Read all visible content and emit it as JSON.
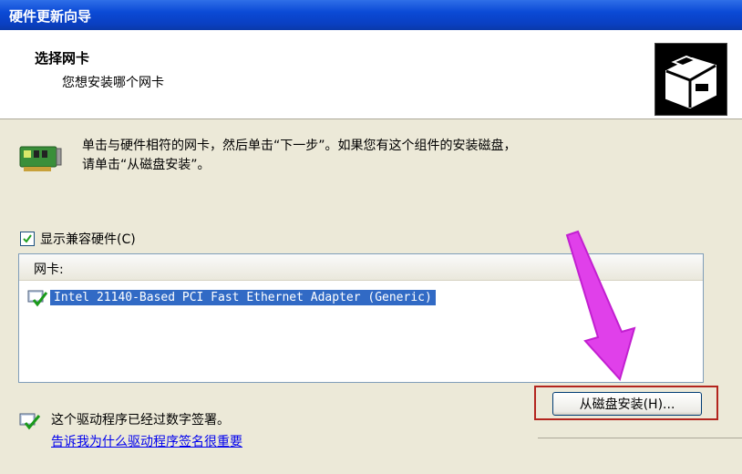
{
  "window": {
    "title": "硬件更新向导"
  },
  "header": {
    "title": "选择网卡",
    "subtitle": "您想安装哪个网卡"
  },
  "instructions": {
    "line1": "单击与硬件相符的网卡，然后单击“下一步”。如果您有这个组件的安装磁盘，",
    "line2": "请单击“从磁盘安装”。"
  },
  "compat_checkbox": {
    "label": "显示兼容硬件(C)",
    "checked": true
  },
  "list": {
    "header": "网卡:",
    "items": [
      {
        "label": "Intel 21140-Based PCI Fast Ethernet Adapter (Generic)",
        "selected": true
      }
    ]
  },
  "footer": {
    "signed_text": "这个驱动程序已经过数字签署。",
    "why_link": "告诉我为什么驱动程序签名很重要"
  },
  "buttons": {
    "have_disk": "从磁盘安装(H)..."
  },
  "colors": {
    "titlebar": "#0a3fc1",
    "selection": "#316ac5",
    "annotation_arrow": "#e040ea",
    "annotation_box": "#b3251e"
  }
}
